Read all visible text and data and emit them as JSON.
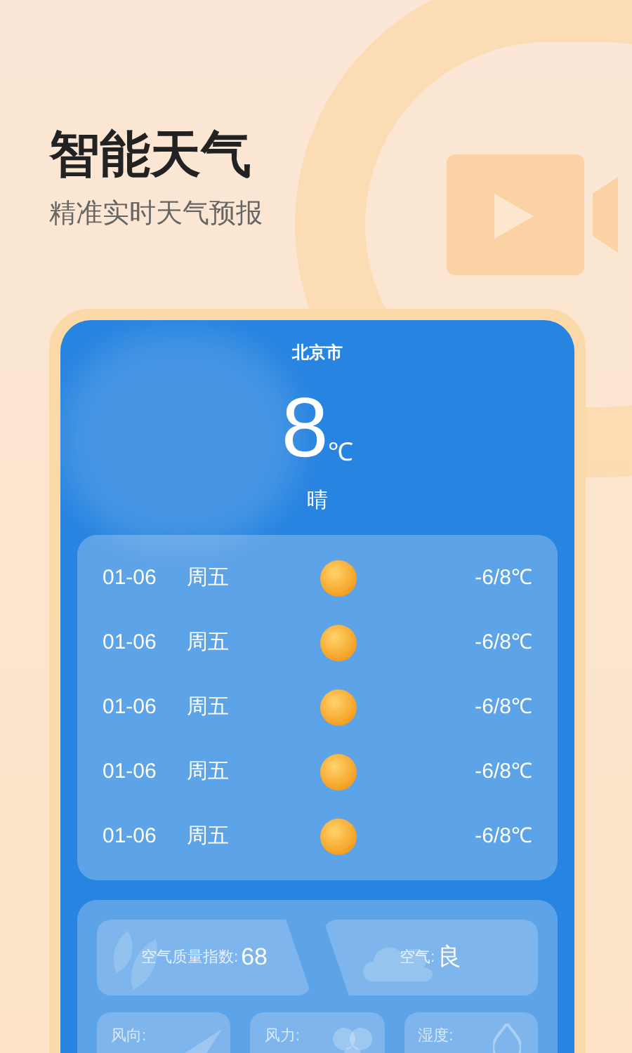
{
  "headline": "智能天气",
  "subtitle": "精准实时天气预报",
  "weather": {
    "city": "北京市",
    "temperature": "8",
    "unit": "℃",
    "condition": "晴"
  },
  "forecast": [
    {
      "date": "01-06",
      "weekday": "周五",
      "range": "-6/8℃"
    },
    {
      "date": "01-06",
      "weekday": "周五",
      "range": "-6/8℃"
    },
    {
      "date": "01-06",
      "weekday": "周五",
      "range": "-6/8℃"
    },
    {
      "date": "01-06",
      "weekday": "周五",
      "range": "-6/8℃"
    },
    {
      "date": "01-06",
      "weekday": "周五",
      "range": "-6/8℃"
    }
  ],
  "air": [
    {
      "kind": "aqi",
      "label": "空气质量指数:",
      "value": "68"
    },
    {
      "kind": "quality",
      "label": "空气:",
      "value": "良"
    }
  ],
  "details": [
    {
      "kind": "wind-direction",
      "label": "风向:"
    },
    {
      "kind": "wind-force",
      "label": "风力:"
    },
    {
      "kind": "humidity",
      "label": "湿度:"
    }
  ]
}
